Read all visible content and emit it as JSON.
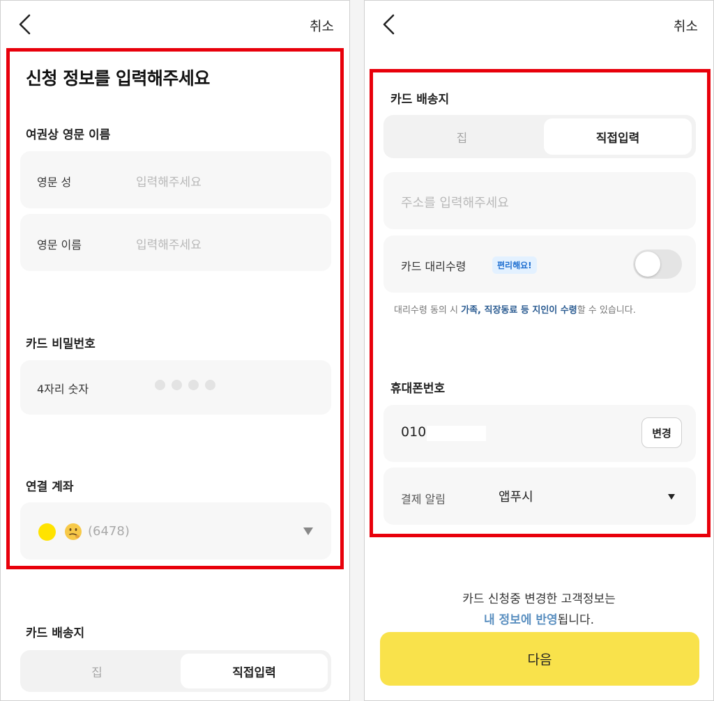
{
  "header": {
    "cancel_label": "취소"
  },
  "left": {
    "title": "신청 정보를 입력해주세요",
    "name_section": "여권상 영문 이름",
    "last_name_label": "영문 성",
    "last_name_placeholder": "입력해주세요",
    "first_name_label": "영문 이름",
    "first_name_placeholder": "입력해주세요",
    "pin_section": "카드 비밀번호",
    "pin_label": "4자리 숫자",
    "account_section": "연결 계좌",
    "account_value": "(6478)",
    "delivery_section": "카드 배송지",
    "delivery_options": [
      "집",
      "직접입력"
    ]
  },
  "right": {
    "delivery_section": "카드 배송지",
    "delivery_options": [
      "집",
      "직접입력"
    ],
    "address_placeholder": "주소를 입력해주세요",
    "proxy_label": "카드 대리수령",
    "proxy_badge": "편리해요!",
    "note_prefix": "대리수령 동의 시 ",
    "note_bold": "가족, 직장동료 등 지인이 수령",
    "note_suffix": "할 수 있습니다.",
    "phone_section": "휴대폰번호",
    "phone_value": "010",
    "change_label": "변경",
    "payment_label": "결제 알림",
    "payment_value": "앱푸시",
    "info_line1": "카드 신청중 변경한 고객정보는",
    "info_bold": "내 정보에 반영",
    "info_suffix": "됩니다.",
    "next_label": "다음"
  },
  "colors": {
    "accent": "#f9e24b",
    "highlight": "#e8000b",
    "link": "#2a5b91"
  }
}
